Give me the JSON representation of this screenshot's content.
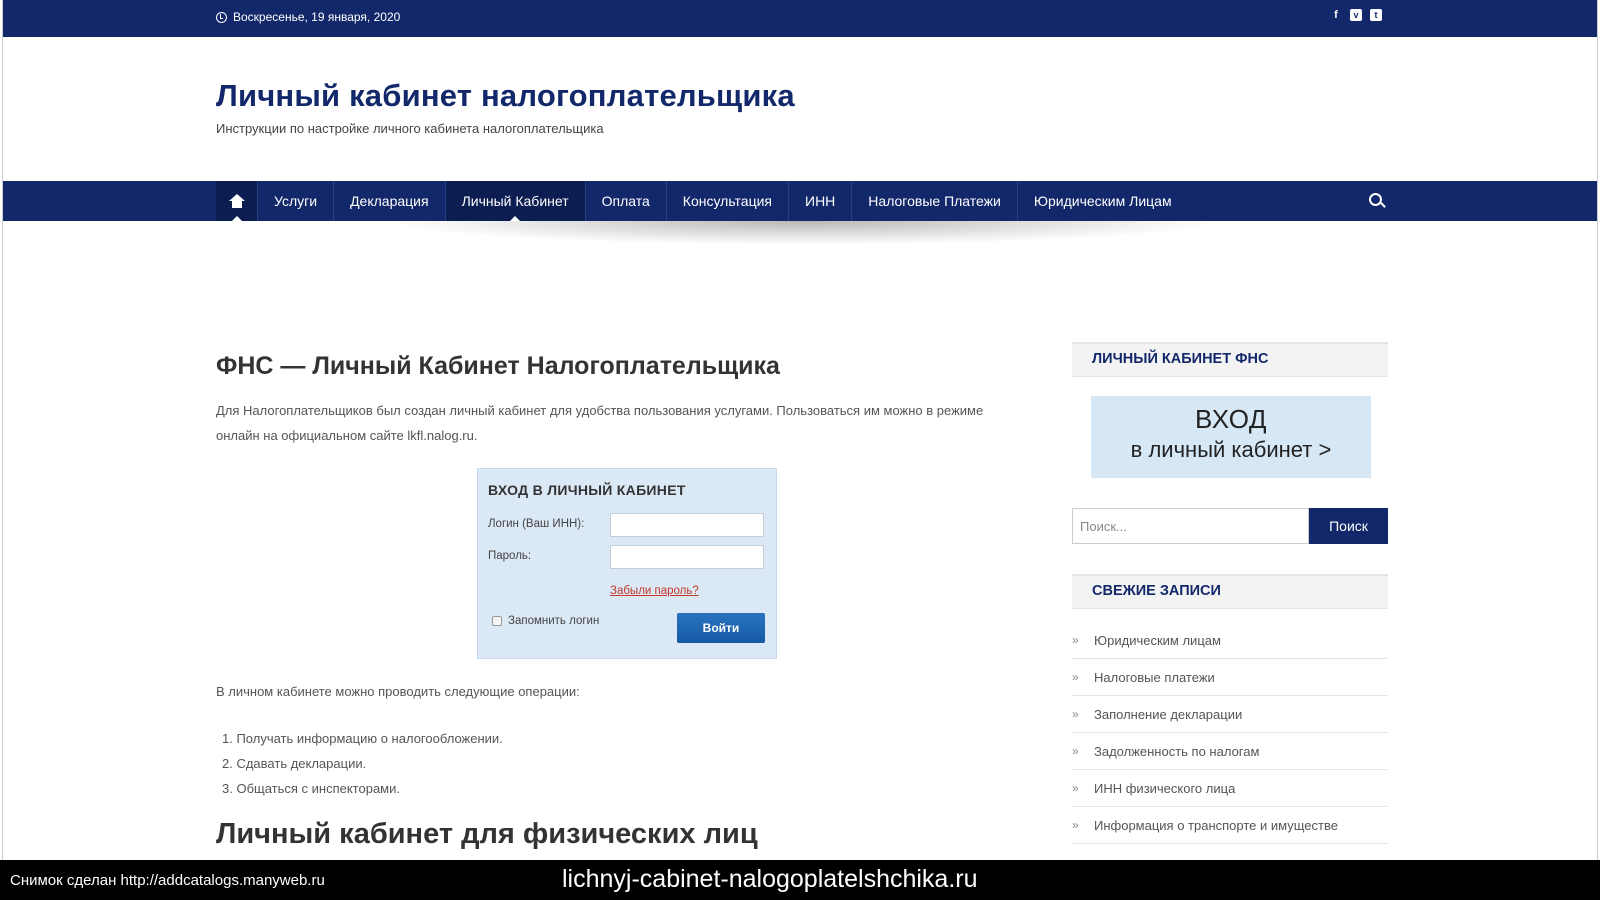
{
  "topbar": {
    "date": "Воскресенье, 19 января, 2020",
    "social": [
      "f",
      "v",
      "t"
    ]
  },
  "site": {
    "title": "Личный кабинет налогоплательщика",
    "description": "Инструкции по настройке личного кабинета налогоплательщика"
  },
  "nav": {
    "items": [
      {
        "label": "Услуги"
      },
      {
        "label": "Декларация"
      },
      {
        "label": "Личный Кабинет"
      },
      {
        "label": "Оплата"
      },
      {
        "label": "Консультация"
      },
      {
        "label": "ИНН"
      },
      {
        "label": "Налоговые Платежи"
      },
      {
        "label": "Юридическим Лицам"
      }
    ]
  },
  "main": {
    "heading": "ФНС — Личный Кабинет Налогоплательщика",
    "intro": "Для Налогоплательщиков был создан личный кабинет для удобства пользования услугами. Пользоваться им можно в режиме онлайн на официальном сайте lkfl.nalog.ru.",
    "login_box": {
      "title": "ВХОД В ЛИЧНЫЙ КАБИНЕТ",
      "login_label": "Логин (Ваш ИНН):",
      "password_label": "Пароль:",
      "forgot": "Забыли пароль?",
      "remember": "Запомнить логин",
      "submit": "Войти"
    },
    "ops_intro": "В личном кабинете можно проводить следующие операции:",
    "ops": [
      "1. Получать информацию о налогообложении.",
      "2. Сдавать декларации.",
      "3. Общаться с инспекторами."
    ],
    "subheading": "Личный кабинет для физических лиц"
  },
  "sidebar": {
    "widget1_title": "ЛИЧНЫЙ КАБИНЕТ ФНС",
    "banner_line1": "ВХОД",
    "banner_line2": "в личный кабинет >",
    "search_placeholder": "Поиск...",
    "search_button": "Поиск",
    "recent_title": "СВЕЖИЕ ЗАПИСИ",
    "recent": [
      "Юридическим лицам",
      "Налоговые платежи",
      "Заполнение декларации",
      "Задолженность по налогам",
      "ИНН физического лица",
      "Информация о транспорте и имуществе"
    ]
  },
  "footer": {
    "left": "Снимок сделан http://addcatalogs.manyweb.ru",
    "center": "lichnyj-cabinet-nalogoplatelshchika.ru"
  },
  "colors": {
    "brand": "#12286b",
    "link_red": "#c0392b",
    "banner_bg": "#d6e7f5"
  }
}
